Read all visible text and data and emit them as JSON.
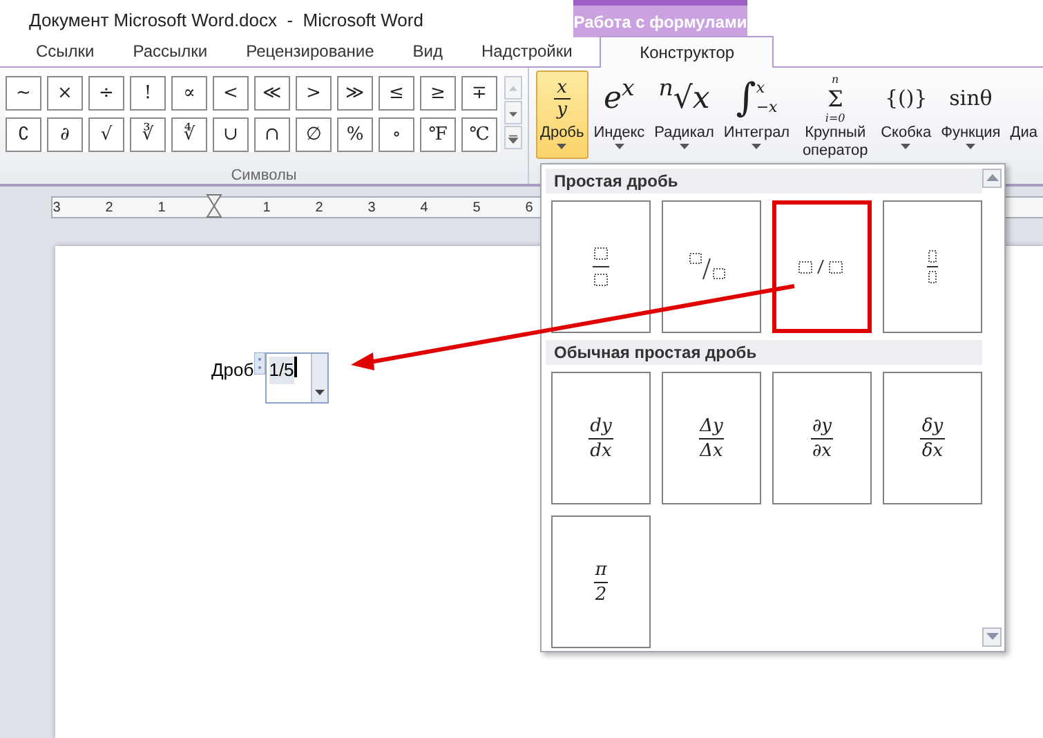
{
  "window": {
    "title": "Документ Microsoft Word.docx  -  Microsoft Word",
    "context_tab_header": "Работа с формулами"
  },
  "tabs": [
    {
      "label": "Ссылки",
      "selected": false
    },
    {
      "label": "Рассылки",
      "selected": false
    },
    {
      "label": "Рецензирование",
      "selected": false
    },
    {
      "label": "Вид",
      "selected": false
    },
    {
      "label": "Надстройки",
      "selected": false
    },
    {
      "label": "Конструктор",
      "selected": true
    }
  ],
  "symbols": {
    "label": "Символы",
    "rows": [
      [
        "∼",
        "×",
        "÷",
        "!",
        "∝",
        "<",
        "≪",
        ">",
        "≫",
        "≤",
        "≥",
        "∓"
      ],
      [
        "∁",
        "∂",
        "√",
        "∛",
        "∜",
        "∪",
        "∩",
        "∅",
        "%",
        "∘",
        "℉",
        "℃"
      ]
    ]
  },
  "structures": [
    {
      "label": "Дробь",
      "selected": true,
      "glyph": {
        "kind": "fraction",
        "num": "x",
        "den": "y"
      }
    },
    {
      "label": "Индекс",
      "selected": false,
      "glyph": {
        "kind": "rich",
        "text": "e$^{x}$"
      }
    },
    {
      "label": "Радикал",
      "selected": false,
      "glyph": {
        "kind": "rich",
        "text": "$^{n}$√x"
      }
    },
    {
      "label": "Интеграл",
      "selected": false,
      "glyph": {
        "kind": "limits_side",
        "main": "∫",
        "top": "x",
        "bottom": "−x"
      }
    },
    {
      "label": "Крупный оператор",
      "selected": false,
      "glyph": {
        "kind": "limits",
        "main": "Σ",
        "top": "n",
        "bottom": "i=0"
      }
    },
    {
      "label": "Скобка",
      "selected": false,
      "glyph": {
        "kind": "rich",
        "text": "{()}"
      }
    },
    {
      "label": "Функция",
      "selected": false,
      "glyph": {
        "kind": "rich",
        "text": "sinθ"
      }
    },
    {
      "label": "Диа",
      "selected": false
    }
  ],
  "ruler": {
    "left_labels": [
      "3",
      "2",
      "1"
    ],
    "right_labels": [
      "1",
      "2",
      "3",
      "4",
      "5",
      "6"
    ]
  },
  "document": {
    "text": "Дроб",
    "equation": "1/5"
  },
  "gallery": {
    "sections": [
      {
        "title": "Простая дробь",
        "tiles": [
          {
            "kind": "stacked",
            "highlighted": false
          },
          {
            "kind": "skewed",
            "highlighted": false
          },
          {
            "kind": "linear",
            "highlighted": true
          },
          {
            "kind": "small_stacked",
            "highlighted": false
          }
        ]
      },
      {
        "title": "Обычная простая дробь",
        "tiles": [
          {
            "kind": "text",
            "num": "dy",
            "den": "dx",
            "highlighted": false
          },
          {
            "kind": "text",
            "num": "Δy",
            "den": "Δx",
            "highlighted": false
          },
          {
            "kind": "text",
            "num": "∂y",
            "den": "∂x",
            "highlighted": false
          },
          {
            "kind": "text",
            "num": "δy",
            "den": "δx",
            "highlighted": false
          },
          {
            "kind": "text",
            "num": "π",
            "den": "2",
            "highlighted": false
          }
        ]
      }
    ]
  }
}
